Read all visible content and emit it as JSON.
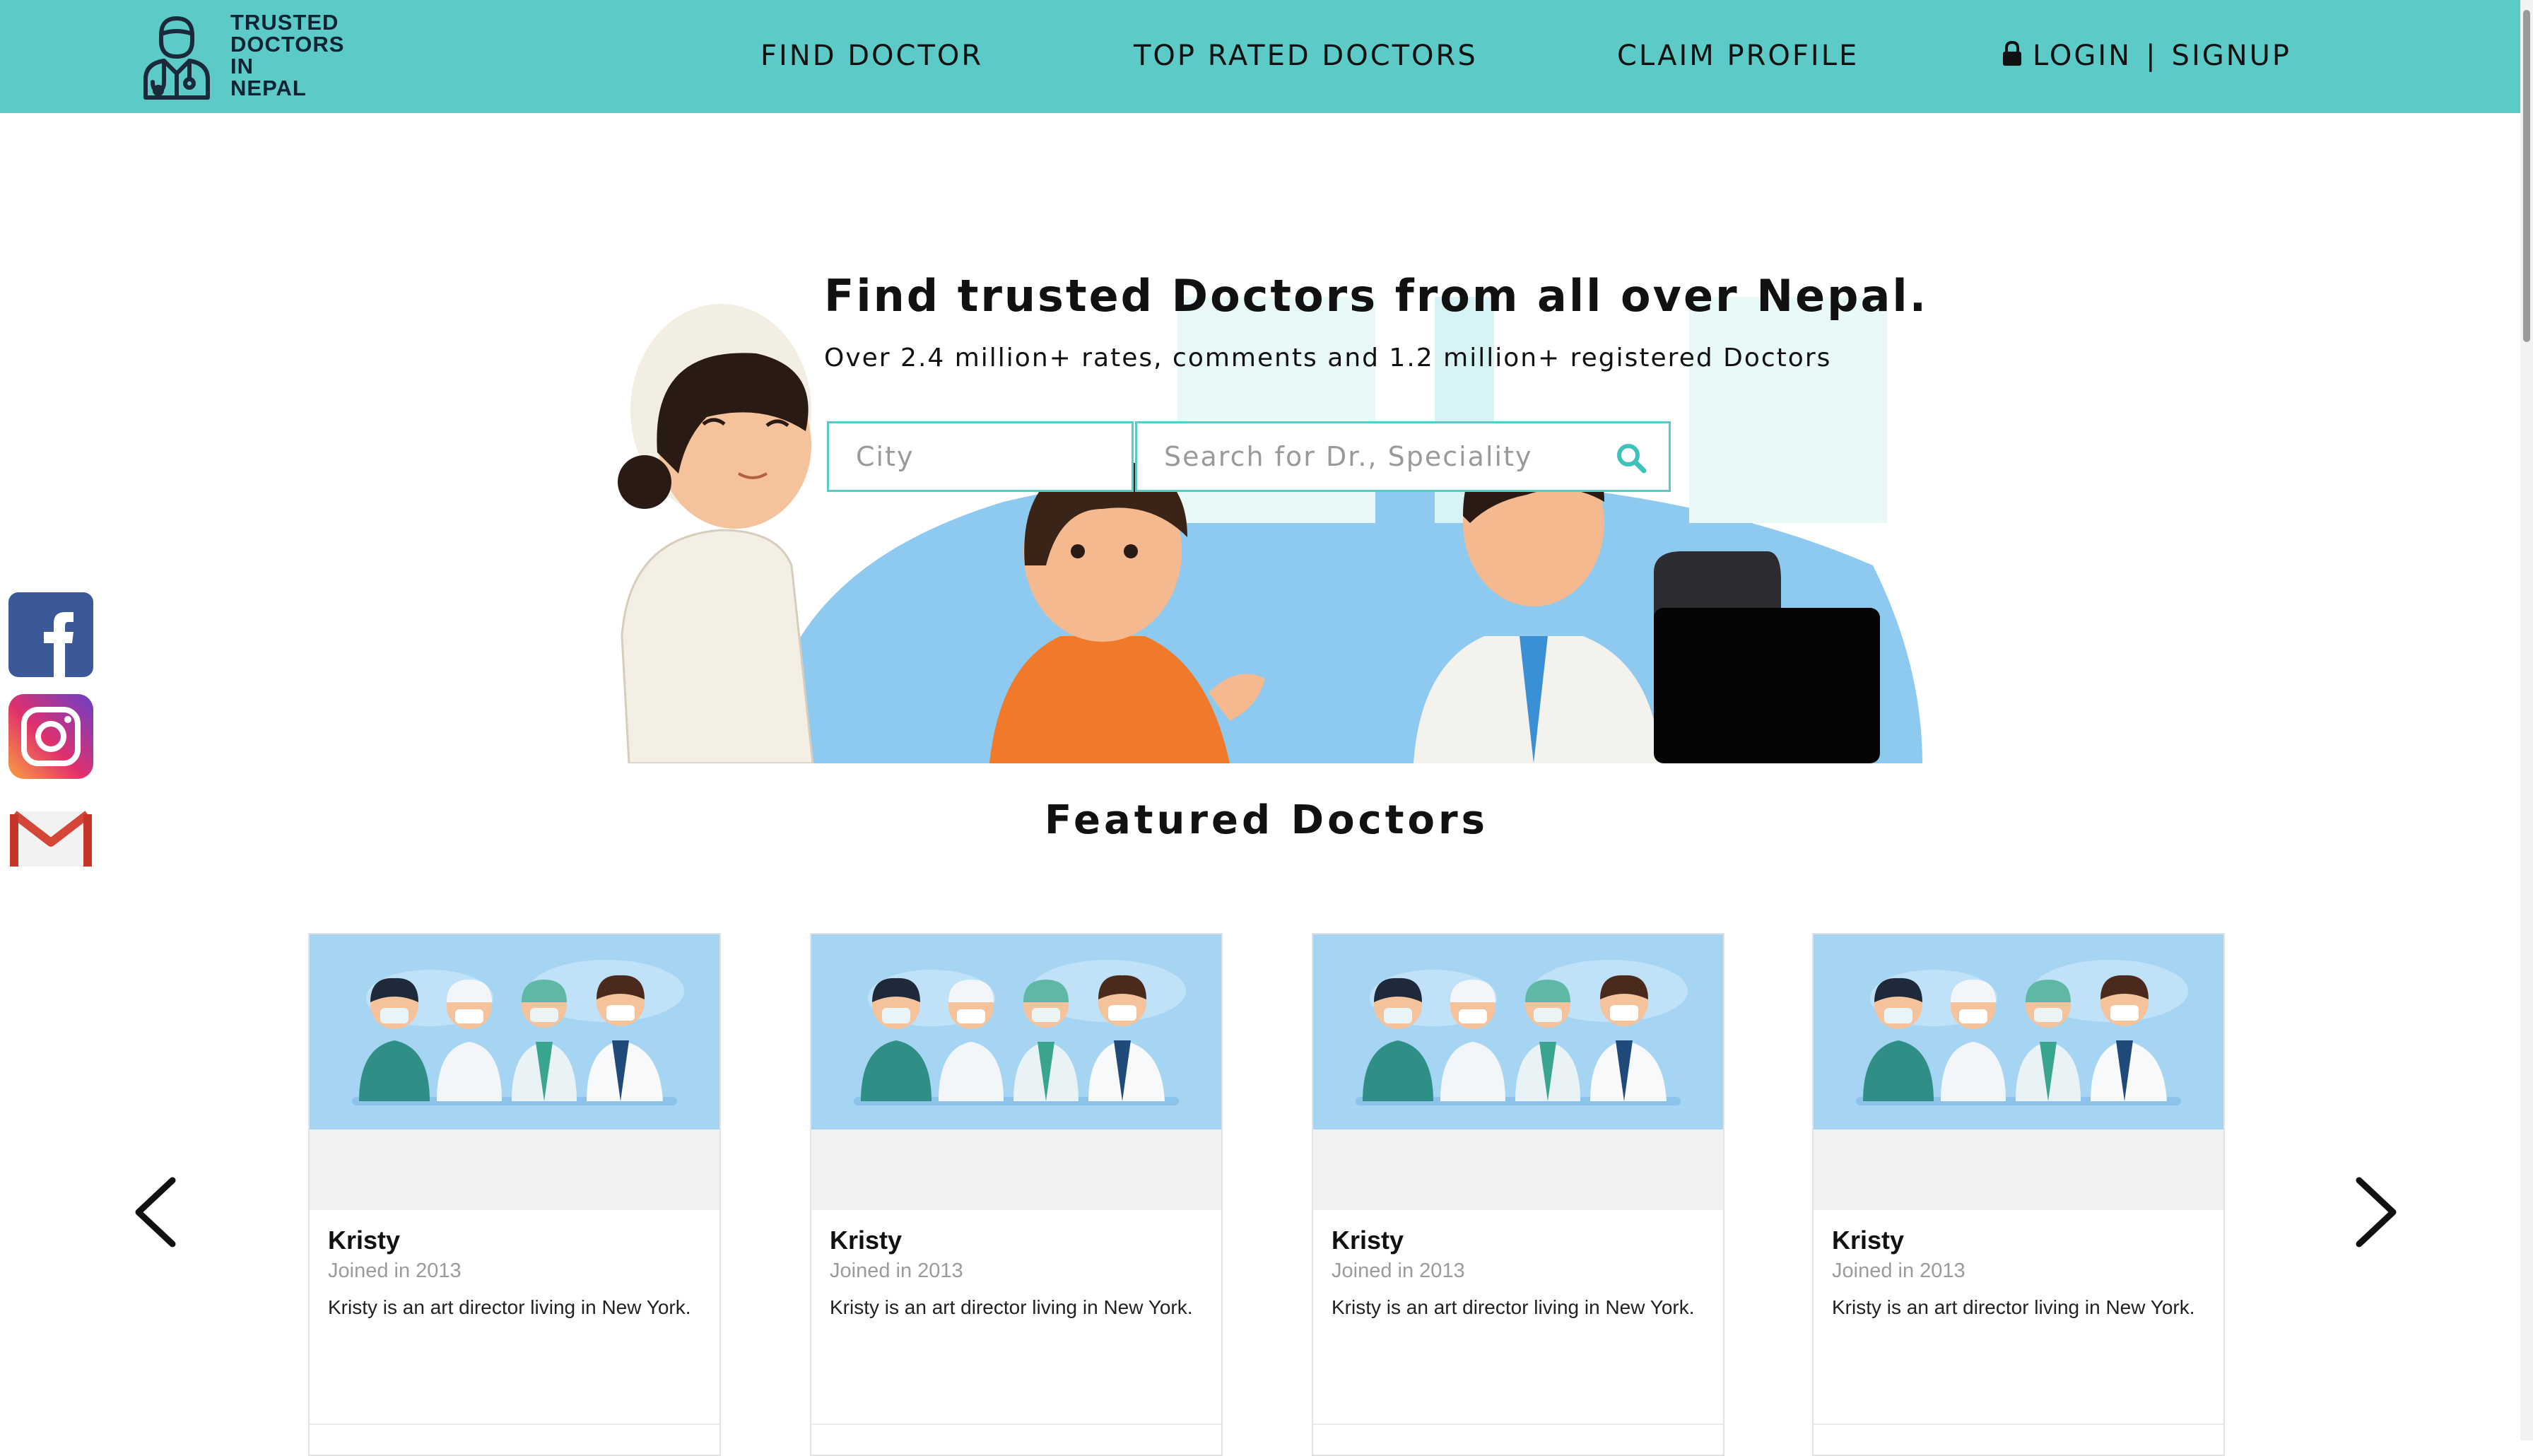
{
  "brand": {
    "logo_lines": [
      "TRUSTED",
      "DOCTORS",
      "IN",
      "NEPAL"
    ],
    "nav_color": "#5ccac6"
  },
  "nav": {
    "items": [
      "FIND DOCTOR",
      "TOP RATED DOCTORS",
      "CLAIM PROFILE"
    ],
    "login": "LOGIN",
    "separator": "|",
    "signup": "SIGNUP"
  },
  "social": [
    "facebook-icon",
    "instagram-icon",
    "gmail-icon"
  ],
  "hero": {
    "title": "Find trusted Doctors from all over Nepal.",
    "subtitle": "Over 2.4 million+ rates, comments and 1.2 million+ registered Doctors",
    "city_placeholder": "City",
    "search_placeholder": "Search for Dr., Speciality"
  },
  "featured": {
    "title": "Featured Doctors",
    "cards": [
      {
        "name": "Kristy",
        "joined": "Joined in 2013",
        "description": "Kristy is an art director living in New York."
      },
      {
        "name": "Kristy",
        "joined": "Joined in 2013",
        "description": "Kristy is an art director living in New York."
      },
      {
        "name": "Kristy",
        "joined": "Joined in 2013",
        "description": "Kristy is an art director living in New York."
      },
      {
        "name": "Kristy",
        "joined": "Joined in 2013",
        "description": "Kristy is an art director living in New York."
      }
    ]
  }
}
